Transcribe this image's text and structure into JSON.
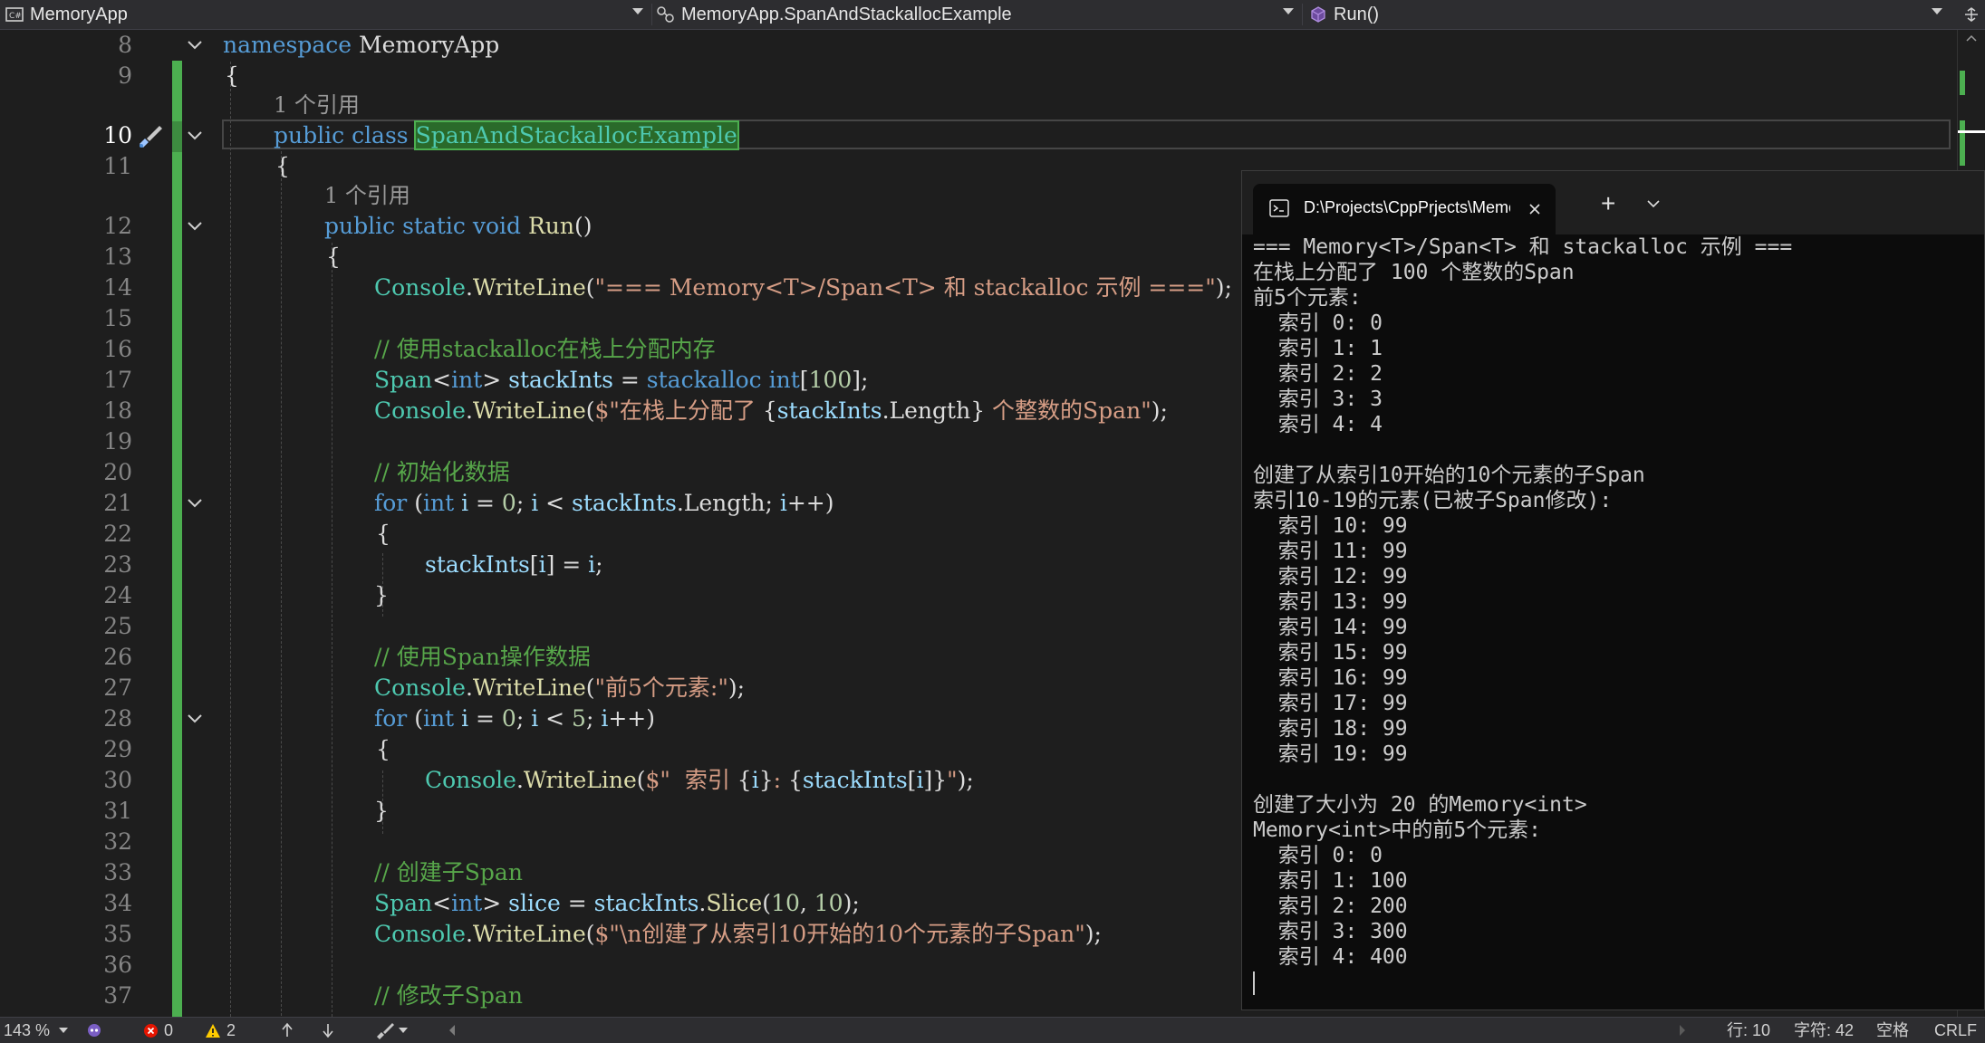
{
  "navbar": {
    "project": "MemoryApp",
    "class_path": "MemoryApp.SpanAndStackallocExample",
    "member": "Run()"
  },
  "editor": {
    "codelens": "1 个引用",
    "lines": {
      "l8": {
        "num": "8",
        "t1": "namespace",
        "t2": " MemoryApp"
      },
      "l9": {
        "num": "9",
        "t1": "{"
      },
      "l10": {
        "num": "10",
        "t1": "public",
        "t2": " ",
        "t3": "class",
        "t4": " ",
        "t5": "SpanAndStackallocExample"
      },
      "l11": {
        "num": "11",
        "t1": "{"
      },
      "l12": {
        "num": "12",
        "t1": "public",
        "t2": " ",
        "t3": "static",
        "t4": " ",
        "t5": "void",
        "t6": " ",
        "t7": "Run",
        "t8": "()"
      },
      "l13": {
        "num": "13",
        "t1": "{"
      },
      "l14": {
        "num": "14",
        "t1": "Console",
        "t2": ".",
        "t3": "WriteLine",
        "t4": "(",
        "t5": "\"=== Memory<T>/Span<T> 和 stackalloc 示例 ===\"",
        "t6": ");"
      },
      "l15": {
        "num": "15"
      },
      "l16": {
        "num": "16",
        "t1": "// 使用stackalloc在栈上分配内存"
      },
      "l17": {
        "num": "17",
        "t1": "Span",
        "t2": "<",
        "t3": "int",
        "t4": "> ",
        "t5": "stackInts",
        "t6": " = ",
        "t7": "stackalloc",
        "t8": " ",
        "t9": "int",
        "t10": "[",
        "t11": "100",
        "t12": "];"
      },
      "l18": {
        "num": "18",
        "t1": "Console",
        "t2": ".",
        "t3": "WriteLine",
        "t4": "(",
        "t5": "$\"在栈上分配了 ",
        "t6": "{",
        "t7": "stackInts",
        "t8": ".Length",
        "t9": "}",
        "t10": " 个整数的Span\"",
        "t11": ");"
      },
      "l19": {
        "num": "19"
      },
      "l20": {
        "num": "20",
        "t1": "// 初始化数据"
      },
      "l21": {
        "num": "21",
        "t1": "for",
        "t2": " (",
        "t3": "int",
        "t4": " ",
        "t5": "i",
        "t6": " = ",
        "t7": "0",
        "t8": "; ",
        "t9": "i",
        "t10": " < ",
        "t11": "stackInts",
        "t12": ".Length; ",
        "t13": "i",
        "t14": "++)"
      },
      "l22": {
        "num": "22",
        "t1": "{"
      },
      "l23": {
        "num": "23",
        "t1": "stackInts",
        "t2": "[",
        "t3": "i",
        "t4": "] = ",
        "t5": "i",
        "t6": ";"
      },
      "l24": {
        "num": "24",
        "t1": "}"
      },
      "l25": {
        "num": "25"
      },
      "l26": {
        "num": "26",
        "t1": "// 使用Span操作数据"
      },
      "l27": {
        "num": "27",
        "t1": "Console",
        "t2": ".",
        "t3": "WriteLine",
        "t4": "(",
        "t5": "\"前5个元素:\"",
        "t6": ");"
      },
      "l28": {
        "num": "28",
        "t1": "for",
        "t2": " (",
        "t3": "int",
        "t4": " ",
        "t5": "i",
        "t6": " = ",
        "t7": "0",
        "t8": "; ",
        "t9": "i",
        "t10": " < ",
        "t11": "5",
        "t12": "; ",
        "t13": "i",
        "t14": "++)"
      },
      "l29": {
        "num": "29",
        "t1": "{"
      },
      "l30": {
        "num": "30",
        "t1": "Console",
        "t2": ".",
        "t3": "WriteLine",
        "t4": "(",
        "t5": "$\"  索引 ",
        "t6": "{",
        "t7": "i",
        "t8": "}",
        "t9": ": ",
        "t10": "{",
        "t11": "stackInts",
        "t12": "[",
        "t13": "i",
        "t14": "]",
        "t15": "}",
        "t16": "\"",
        "t17": ");"
      },
      "l31": {
        "num": "31",
        "t1": "}"
      },
      "l32": {
        "num": "32"
      },
      "l33": {
        "num": "33",
        "t1": "// 创建子Span"
      },
      "l34": {
        "num": "34",
        "t1": "Span",
        "t2": "<",
        "t3": "int",
        "t4": "> ",
        "t5": "slice",
        "t6": " = ",
        "t7": "stackInts",
        "t8": ".",
        "t9": "Slice",
        "t10": "(",
        "t11": "10",
        "t12": ", ",
        "t13": "10",
        "t14": ");"
      },
      "l35": {
        "num": "35",
        "t1": "Console",
        "t2": ".",
        "t3": "WriteLine",
        "t4": "(",
        "t5": "$\"\\n创建了从索引10开始的10个元素的子Span\"",
        "t6": ");"
      },
      "l36": {
        "num": "36"
      },
      "l37": {
        "num": "37",
        "t1": "// 修改子Span"
      }
    }
  },
  "console": {
    "tab_title": "D:\\Projects\\CppPrjects\\MemoryApp",
    "new_tab_symbol": "+",
    "output": [
      "=== Memory<T>/Span<T> 和 stackalloc 示例 ===",
      "在栈上分配了 100 个整数的Span",
      "前5个元素:",
      "  索引 0: 0",
      "  索引 1: 1",
      "  索引 2: 2",
      "  索引 3: 3",
      "  索引 4: 4",
      "",
      "创建了从索引10开始的10个元素的子Span",
      "索引10-19的元素(已被子Span修改):",
      "  索引 10: 99",
      "  索引 11: 99",
      "  索引 12: 99",
      "  索引 13: 99",
      "  索引 14: 99",
      "  索引 15: 99",
      "  索引 16: 99",
      "  索引 17: 99",
      "  索引 18: 99",
      "  索引 19: 99",
      "",
      "创建了大小为 20 的Memory<int>",
      "Memory<int>中的前5个元素:",
      "  索引 0: 0",
      "  索引 1: 100",
      "  索引 2: 200",
      "  索引 3: 300",
      "  索引 4: 400"
    ]
  },
  "statusbar": {
    "zoom": "143 %",
    "errors": "0",
    "warnings": "2",
    "line": "行: 10",
    "char": "字符: 42",
    "spacing": "空格",
    "line_ending": "CRLF"
  },
  "colors": {
    "background": "#1e1e1e",
    "keyword": "#569cd6",
    "type": "#4ec9b0",
    "method": "#dcdcaa",
    "string": "#d69d85",
    "comment": "#57a64a",
    "variable": "#9cdcfe",
    "change_bar": "#4caf50",
    "error": "#e51400",
    "warning": "#ffcc00"
  }
}
